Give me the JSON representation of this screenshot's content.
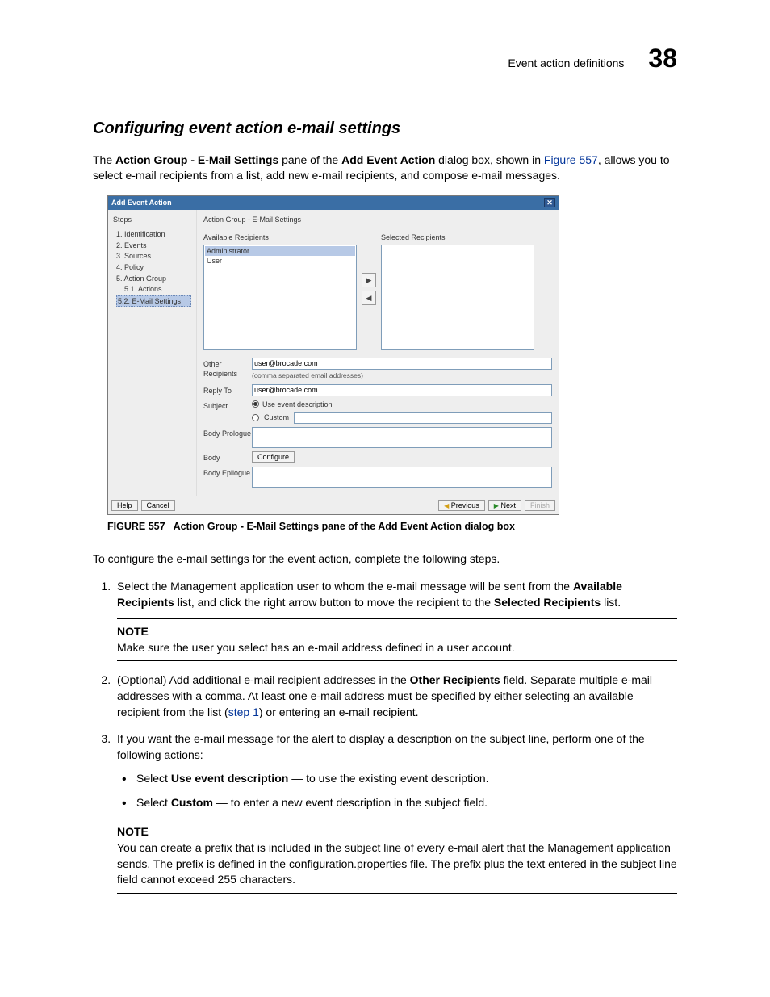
{
  "header": {
    "title": "Event action definitions",
    "chapter": "38"
  },
  "section_title": "Configuring event action e-mail settings",
  "intro": {
    "t1": "The ",
    "b1": "Action Group - E-Mail Settings",
    "t2": " pane of the ",
    "b2": "Add Event Action",
    "t3": " dialog box, shown in ",
    "link": "Figure 557",
    "t4": ", allows you to select e-mail recipients from a list, add new e-mail recipients, and compose e-mail messages."
  },
  "dlg": {
    "title": "Add Event Action",
    "steps_label": "Steps",
    "steps": {
      "s1": "1. Identification",
      "s2": "2. Events",
      "s3": "3. Sources",
      "s4": "4. Policy",
      "s5": "5. Action Group",
      "s51": "5.1. Actions",
      "s52": "5.2. E-Mail Settings"
    },
    "pane_title": "Action Group - E-Mail Settings",
    "avail_label": "Available Recipients",
    "sel_label": "Selected Recipients",
    "avail_items": {
      "a": "Administrator",
      "b": "User"
    },
    "other_label": "Other Recipients",
    "other_value": "user@brocade.com",
    "other_hint": "(comma separated email addresses)",
    "reply_label": "Reply To",
    "reply_value": "user@brocade.com",
    "subject_label": "Subject",
    "subject_opt1": "Use event description",
    "subject_opt2": "Custom",
    "prologue_label": "Body Prologue",
    "body_label": "Body",
    "configure": "Configure",
    "epilogue_label": "Body Epilogue",
    "footer": {
      "help": "Help",
      "cancel": "Cancel",
      "prev": "Previous",
      "next": "Next",
      "finish": "Finish"
    }
  },
  "figcap": {
    "num": "FIGURE 557",
    "text": "Action Group - E-Mail Settings pane of the Add Event Action dialog box"
  },
  "para2": "To configure the e-mail settings for the event action, complete the following steps.",
  "step1": {
    "t1": "Select the Management application user to whom the e-mail message will be sent from the ",
    "b1": "Available Recipients",
    "t2": " list, and click the right arrow button to move the recipient to the ",
    "b2": "Selected Recipients",
    "t3": " list."
  },
  "note1": {
    "label": "NOTE",
    "text": "Make sure the user you select has an e-mail address defined in a user account."
  },
  "step2": {
    "t1": "(Optional) Add additional e-mail recipient addresses in the ",
    "b1": "Other Recipients",
    "t2": " field. Separate multiple e-mail addresses with a comma. At least one e-mail address must be specified by either selecting an available recipient from the list (",
    "link": "step 1",
    "t3": ") or entering an e-mail recipient."
  },
  "step3": {
    "intro": "If you want the e-mail message for the alert to display a description on the subject line, perform one of the following actions:",
    "bullet1": {
      "t1": "Select ",
      "b": "Use event description",
      "t2": " — to use the existing event description."
    },
    "bullet2": {
      "t1": "Select ",
      "b": "Custom",
      "t2": " — to enter a new event description in the subject field."
    }
  },
  "note2": {
    "label": "NOTE",
    "text": "You can create a prefix that is included in the subject line of every e-mail alert that the Management application sends. The prefix is defined in the configuration.properties file. The prefix plus the text entered in the subject line field cannot exceed 255 characters."
  }
}
